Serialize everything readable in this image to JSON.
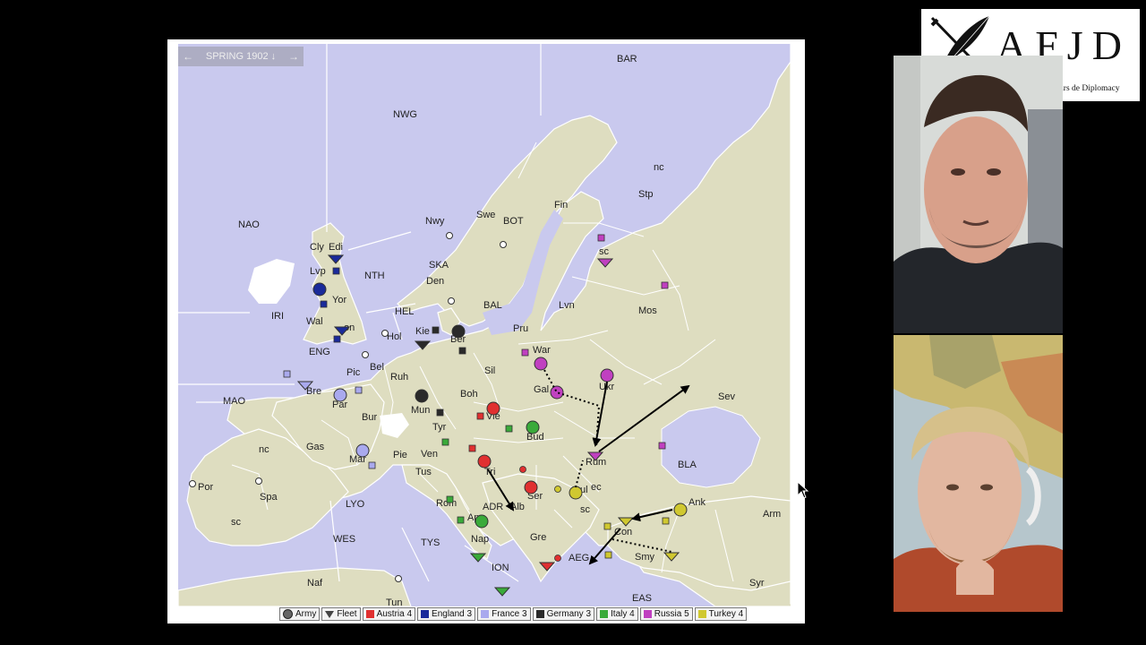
{
  "phase_bar": {
    "label": "SPRING 1902",
    "down_icon": "↓",
    "prev_icon": "←",
    "next_icon": "→"
  },
  "map": {
    "territory_labels": {
      "bar": "BAR",
      "nwg": "NWG",
      "nao": "NAO",
      "nth": "NTH",
      "iri": "IRI",
      "eng": "ENG",
      "mao": "MAO",
      "hel": "HEL",
      "ska": "SKA",
      "bal": "BAL",
      "bot": "BOT",
      "lyo": "LYO",
      "wes": "WES",
      "tys": "TYS",
      "adr": "ADR",
      "ion": "ION",
      "aeg": "AEG",
      "eas": "EAS",
      "bla": "BLA",
      "cly": "Cly",
      "edi": "Edi",
      "lvp": "Lvp",
      "yor": "Yor",
      "wal": "Wal",
      "lon": "on",
      "bre": "Bre",
      "pic": "Pic",
      "par": "Par",
      "bel": "Bel",
      "hol": "Hol",
      "bur": "Bur",
      "gas": "Gas",
      "mar": "Mar",
      "por": "Por",
      "spa": "Spa",
      "spa_sc": "sc",
      "spa_nc": "nc",
      "nwy": "Nwy",
      "swe": "Swe",
      "den": "Den",
      "fin": "Fin",
      "stp": "Stp",
      "stp_nc": "nc",
      "stp_sc": "sc",
      "lvn": "Lvn",
      "mos": "Mos",
      "pru": "Pru",
      "war": "War",
      "kie": "Kie",
      "ber": "Ber",
      "ruh": "Ruh",
      "sil": "Sil",
      "mun": "Mun",
      "boh": "Boh",
      "gal": "Gal",
      "ukr": "Ukr",
      "sev": "Sev",
      "tyr": "Tyr",
      "vie": "Vie",
      "bud": "Bud",
      "rum": "Rum",
      "pie": "Pie",
      "ven": "Ven",
      "tus": "Tus",
      "tri": "Tri",
      "ser": "Ser",
      "bul": "ul",
      "bul_ec": "ec",
      "bul_sc": "sc",
      "rom": "Rom",
      "apu": "Apu",
      "nap": "Nap",
      "alb": "Alb",
      "gre": "Gre",
      "con": "Con",
      "ank": "Ank",
      "smy": "Smy",
      "arm": "Arm",
      "syr": "Syr",
      "naf": "Naf",
      "tun": "Tun"
    }
  },
  "legend": {
    "army": "Army",
    "fleet": "Fleet",
    "austria": "Austria 4",
    "england": "England 3",
    "france": "France 3",
    "germany": "Germany 3",
    "italy": "Italy 4",
    "russia": "Russia 5",
    "turkey": "Turkey 4"
  },
  "colors": {
    "sea": "#c9c9ee",
    "land": "#deddc0",
    "austria": "#e03030",
    "england": "#1a2a9a",
    "france": "#a9a9ee",
    "germany": "#2a2a2a",
    "italy": "#3aaa3a",
    "russia": "#c040c0",
    "turkey": "#d0c830"
  },
  "logo": {
    "title": "AFJD",
    "subtitle": "Association Francophone des Joueurs de Diplomacy",
    "emblem": "quill-and-sword-icon"
  }
}
